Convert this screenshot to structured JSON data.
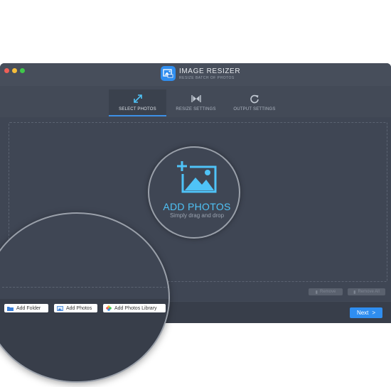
{
  "app": {
    "title": "IMAGE RESIZER",
    "subtitle": "RESIZE BATCH OF PHOTOS"
  },
  "tabs": [
    {
      "label": "SELECT PHOTOS",
      "icon": "expand-arrows-icon",
      "active": true
    },
    {
      "label": "RESIZE SETTINGS",
      "icon": "resize-handles-icon",
      "active": false
    },
    {
      "label": "OUTPUT SETTINGS",
      "icon": "refresh-icon",
      "active": false
    }
  ],
  "dropzone": {
    "title": "ADD PHOTOS",
    "subtitle": "Simply drag and drop"
  },
  "actions": {
    "remove": "Remove",
    "remove_all": "Remove All",
    "next": "Next",
    "next_glyph": ">"
  },
  "add_buttons": {
    "folder": "Add Folder",
    "photos": "Add Photos",
    "library": "Add Photos Library"
  },
  "colors": {
    "accent": "#2f8ef0",
    "cyan": "#4fc3f7",
    "window_bg": "#434a57"
  }
}
